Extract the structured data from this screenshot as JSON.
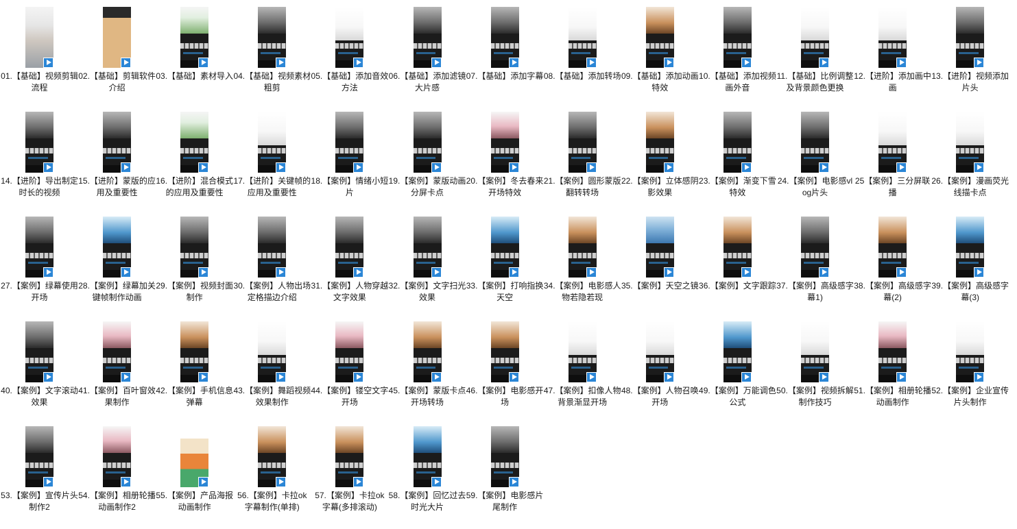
{
  "items": [
    {
      "label": "01.【基础】视频剪辑流程",
      "thumb": "face"
    },
    {
      "label": "02.【基础】剪辑软件介绍",
      "thumb": "tan"
    },
    {
      "label": "03.【基础】素材导入",
      "thumb": "green"
    },
    {
      "label": "04.【基础】视频素材粗剪",
      "thumb": "dark"
    },
    {
      "label": "05.【基础】添加音效方法",
      "thumb": "white"
    },
    {
      "label": "06.【基础】添加滤镜大片感",
      "thumb": "dark"
    },
    {
      "label": "07.【基础】添加字幕",
      "thumb": "dark"
    },
    {
      "label": "08.【基础】添加转场",
      "thumb": "white"
    },
    {
      "label": "09.【基础】添加动画特效",
      "thumb": "warm"
    },
    {
      "label": "10.【基础】添加视频画外音",
      "thumb": "dark"
    },
    {
      "label": "11.【基础】比例调整及背景颜色更换",
      "thumb": "white"
    },
    {
      "label": "12.【进阶】添加画中画",
      "thumb": "white"
    },
    {
      "label": "13.【进阶】视频添加片头",
      "thumb": "dark"
    },
    {
      "label": "14.【进阶】导出制定时长的视频",
      "thumb": "dark"
    },
    {
      "label": "15.【进阶】蒙版的应用及重要性",
      "thumb": "dark"
    },
    {
      "label": "16.【进阶】混合模式的应用及重要性",
      "thumb": "green"
    },
    {
      "label": "17.【进阶】关键帧的应用及重要性",
      "thumb": "white"
    },
    {
      "label": "18.【案例】情绪小短片",
      "thumb": "dark"
    },
    {
      "label": "19.【案例】蒙版动画分屏卡点",
      "thumb": "dark"
    },
    {
      "label": "20.【案例】冬去春来开场特效",
      "thumb": "pink"
    },
    {
      "label": "21.【案例】圆形蒙版翻转转场",
      "thumb": "dark"
    },
    {
      "label": "22.【案例】立体感阴影效果",
      "thumb": "warm"
    },
    {
      "label": "23.【案例】渐变下雪特效",
      "thumb": "dark"
    },
    {
      "label": "24.【案例】电影感vlog片头",
      "thumb": "dark"
    },
    {
      "label": "25【案例】三分屏联播",
      "thumb": "white"
    },
    {
      "label": "26.【案例】漫画荧光线描卡点",
      "thumb": "white"
    },
    {
      "label": "27.【案例】绿幕使用开场",
      "thumb": "dark"
    },
    {
      "label": "28.【案例】绿幕加关键帧制作动画",
      "thumb": "sky"
    },
    {
      "label": "29.【案例】视频封面制作",
      "thumb": "dark"
    },
    {
      "label": "30.【案例】人物出场定格描边介绍",
      "thumb": "dark"
    },
    {
      "label": "31.【案例】人物穿越文字效果",
      "thumb": "dark"
    },
    {
      "label": "32.【案例】文字扫光效果",
      "thumb": "dark"
    },
    {
      "label": "33.【案例】打响指换天空",
      "thumb": "sky"
    },
    {
      "label": "34.【案例】电影感人物若隐若现",
      "thumb": "warm"
    },
    {
      "label": "35.【案例】天空之镜",
      "thumb": "blue"
    },
    {
      "label": "36.【案例】文字跟踪",
      "thumb": "warm"
    },
    {
      "label": "37.【案例】高级感字幕1)",
      "thumb": "dark"
    },
    {
      "label": "38.【案例】高级感字幕(2)",
      "thumb": "warm"
    },
    {
      "label": "39.【案例】高级感字幕(3)",
      "thumb": "sky"
    },
    {
      "label": "40.【案例】文字滚动效果",
      "thumb": "dark"
    },
    {
      "label": "41.【案例】百叶窗效果制作",
      "thumb": "pink"
    },
    {
      "label": "42.【案例】手机信息弹幕",
      "thumb": "warm"
    },
    {
      "label": "43.【案例】舞蹈视频效果制作",
      "thumb": "white"
    },
    {
      "label": "44.【案例】镂空文字开场",
      "thumb": "pink"
    },
    {
      "label": "45.【案例】蒙版卡点开场转场",
      "thumb": "warm"
    },
    {
      "label": "46.【案例】电影感开场",
      "thumb": "warm"
    },
    {
      "label": "47.【案例】扣像人物背景渐显开场",
      "thumb": "white"
    },
    {
      "label": "48.【案例】人物召唤开场",
      "thumb": "white"
    },
    {
      "label": "49.【案例】万能调色公式",
      "thumb": "sky"
    },
    {
      "label": "50.【案例】视频拆解制作技巧",
      "thumb": "white"
    },
    {
      "label": "51.【案例】相册轮播动画制作",
      "thumb": "pink"
    },
    {
      "label": "52.【案例】企业宣传片头制作",
      "thumb": "white"
    },
    {
      "label": "53.【案例】宣传片头制作2",
      "thumb": "dark"
    },
    {
      "label": "54.【案例】相册轮播动画制作2",
      "thumb": "pink"
    },
    {
      "label": "55.【案例】产品海报动画制作",
      "thumb": "poster"
    },
    {
      "label": "56.【案例】卡拉ok字幕制作(单排)",
      "thumb": "warm"
    },
    {
      "label": "57.【案例】卡拉ok字幕(多排滚动)",
      "thumb": "warm"
    },
    {
      "label": "58.【案例】回忆过去时光大片",
      "thumb": "sky"
    },
    {
      "label": "59.【案例】电影感片尾制作",
      "thumb": "dark"
    }
  ]
}
